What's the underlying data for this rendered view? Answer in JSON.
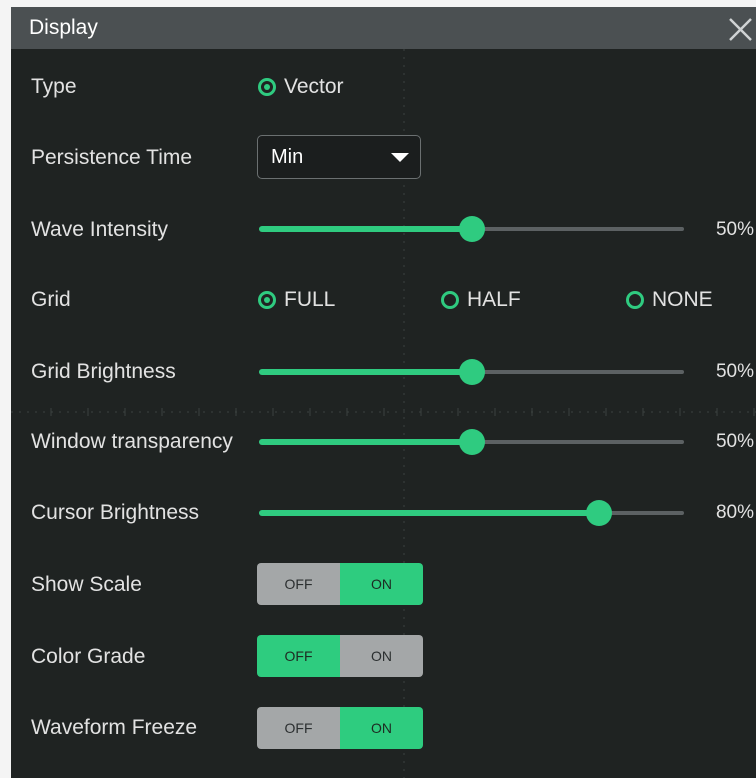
{
  "dialog": {
    "title": "Display",
    "close_icon": "close-icon"
  },
  "colors": {
    "accent": "#2fcb80",
    "panel": "#1f2322",
    "title_bar": "#4b5052"
  },
  "type": {
    "label": "Type",
    "options": [
      {
        "label": "Vector",
        "selected": true
      }
    ]
  },
  "persistence": {
    "label": "Persistence Time",
    "value": "Min",
    "icon": "caret-down-icon"
  },
  "wave_intensity": {
    "label": "Wave Intensity",
    "value": 50,
    "value_text": "50%"
  },
  "grid": {
    "label": "Grid",
    "options": [
      {
        "label": "FULL",
        "selected": true
      },
      {
        "label": "HALF",
        "selected": false
      },
      {
        "label": "NONE",
        "selected": false
      }
    ]
  },
  "grid_brightness": {
    "label": "Grid Brightness",
    "value": 50,
    "value_text": "50%"
  },
  "window_transparency": {
    "label": "Window transparency",
    "value": 50,
    "value_text": "50%"
  },
  "cursor_brightness": {
    "label": "Cursor Brightness",
    "value": 80,
    "value_text": "80%"
  },
  "show_scale": {
    "label": "Show Scale",
    "off_label": "OFF",
    "on_label": "ON",
    "state": "ON"
  },
  "color_grade": {
    "label": "Color Grade",
    "off_label": "OFF",
    "on_label": "ON",
    "state": "OFF"
  },
  "waveform_freeze": {
    "label": "Waveform Freeze",
    "off_label": "OFF",
    "on_label": "ON",
    "state": "ON"
  }
}
